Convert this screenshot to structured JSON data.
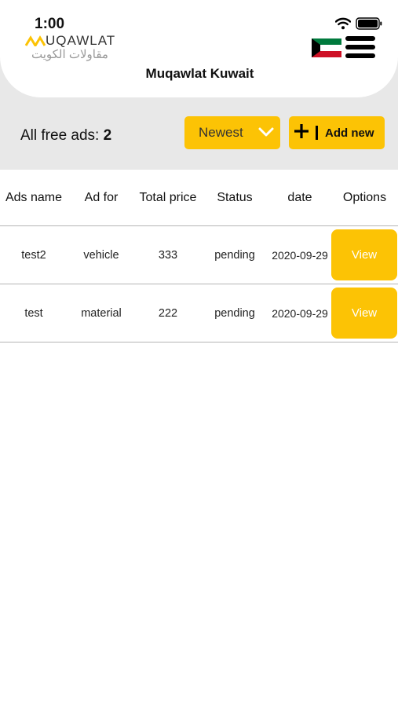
{
  "status_bar": {
    "time": "1:00"
  },
  "header": {
    "logo_latin": "UQAWLAT",
    "logo_arabic": "مقاولات الكويت",
    "title": "Muqawlat Kuwait"
  },
  "toolbar": {
    "free_ads_label": "All free ads:",
    "free_ads_count": "2",
    "sort_selected": "Newest",
    "add_label": "Add new"
  },
  "table": {
    "columns": [
      "Ads name",
      "Ad for",
      "Total price",
      "Status",
      "date",
      "Options"
    ],
    "rows": [
      {
        "name": "test2",
        "ad_for": "vehicle",
        "price": "333",
        "status": "pending",
        "date": "2020-09-29",
        "action": "View"
      },
      {
        "name": "test",
        "ad_for": "material",
        "price": "222",
        "status": "pending",
        "date": "2020-09-29",
        "action": "View"
      }
    ]
  },
  "colors": {
    "accent": "#fcc305",
    "band": "#e8e8e8"
  },
  "icons": [
    "wifi-icon",
    "battery-icon",
    "kuwait-flag-icon",
    "hamburger-menu-icon",
    "chevron-down-icon",
    "plus-icon"
  ]
}
